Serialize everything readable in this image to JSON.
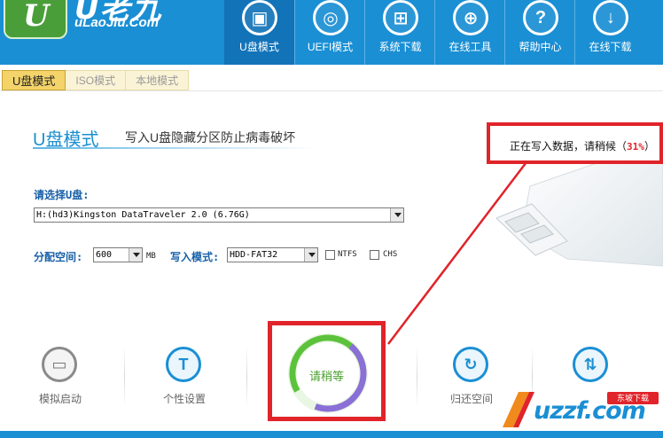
{
  "app": {
    "logo_mark": "U",
    "logo_title": "U老九",
    "logo_url": "uLaoJiu.Com"
  },
  "nav": [
    {
      "label": "U盘模式",
      "icon": "usb-disk-icon",
      "glyph": "▣"
    },
    {
      "label": "UEFI模式",
      "icon": "disc-icon",
      "glyph": "◎"
    },
    {
      "label": "系统下载",
      "icon": "windows-icon",
      "glyph": "⊞"
    },
    {
      "label": "在线工具",
      "icon": "globe-icon",
      "glyph": "⊕"
    },
    {
      "label": "帮助中心",
      "icon": "help-icon",
      "glyph": "?"
    },
    {
      "label": "在线下载",
      "icon": "download-icon",
      "glyph": "↓"
    }
  ],
  "tabs": [
    {
      "label": "U盘模式",
      "active": true
    },
    {
      "label": "ISO模式",
      "active": false
    },
    {
      "label": "本地模式",
      "active": false
    }
  ],
  "main": {
    "title": "U盘模式",
    "subtitle": "写入U盘隐藏分区防止病毒破坏"
  },
  "status": {
    "text": "正在写入数据，请稍候（",
    "percent": "31%",
    "close": "）"
  },
  "form": {
    "select_disk_label": "请选择U盘:",
    "disk_value": "H:(hd3)Kingston DataTraveler 2.0 (6.76G)",
    "alloc_label": "分配空间:",
    "alloc_value": "600",
    "alloc_unit": "MB",
    "write_mode_label": "写入模式:",
    "write_mode_value": "HDD-FAT32",
    "ntfs_label": "NTFS",
    "chs_label": "CHS"
  },
  "actions": {
    "simulate": "模拟启动",
    "personalize": "个性设置",
    "wait": "请稍等",
    "restore": "归还空间"
  },
  "watermark": {
    "text": "uzzf.com",
    "badge": "东坡下载"
  },
  "colors": {
    "header_blue": "#1a8fd4",
    "highlight_red": "#e0242a",
    "progress_green": "#4aa02c",
    "progress_purple": "#8a6fd6"
  }
}
